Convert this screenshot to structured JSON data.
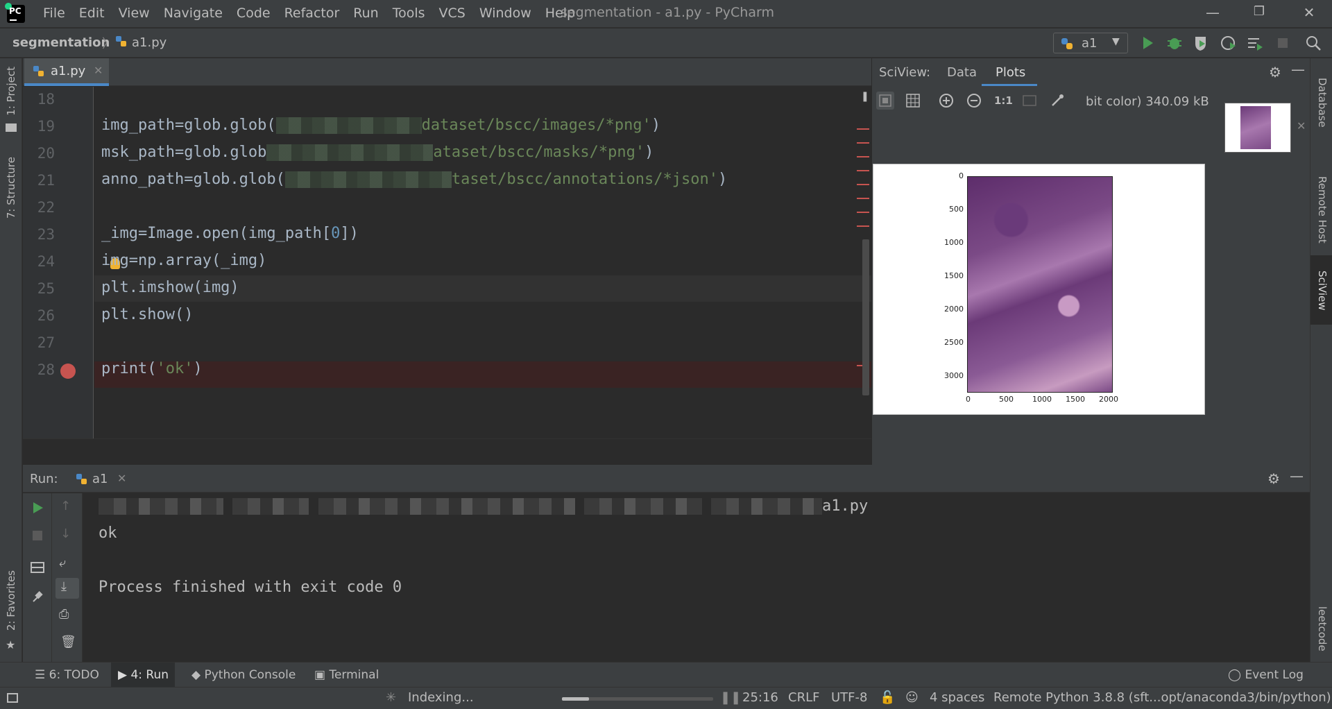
{
  "window": {
    "title": "segmentation - a1.py - PyCharm",
    "menu": [
      "File",
      "Edit",
      "View",
      "Navigate",
      "Code",
      "Refactor",
      "Run",
      "Tools",
      "VCS",
      "Window",
      "Help"
    ],
    "buttons": {
      "minimize": "—",
      "restore": "❐",
      "close": "✕"
    }
  },
  "navbar": {
    "project": "segmentation",
    "file": "a1.py",
    "run_config": "a1"
  },
  "left_strip": {
    "project": "1: Project",
    "structure": "7: Structure",
    "favorites": "2: Favorites"
  },
  "right_strip": {
    "database": "Database",
    "remote_host": "Remote Host",
    "sciview": "SciView",
    "leetcode": "leetcode"
  },
  "editor": {
    "tab": "a1.py",
    "lines": [
      {
        "n": "18",
        "parts": []
      },
      {
        "n": "19",
        "parts": [
          [
            "c",
            "img_path=glob.glob("
          ],
          [
            "r",
            ""
          ],
          [
            "s",
            "dataset/bscc/images/*png'"
          ],
          [
            "c",
            ")"
          ]
        ]
      },
      {
        "n": "20",
        "parts": [
          [
            "c",
            "msk_path=glob.glob"
          ],
          [
            "r",
            ""
          ],
          [
            "s",
            "ataset/bscc/masks/*png'"
          ],
          [
            "c",
            ")"
          ]
        ]
      },
      {
        "n": "21",
        "parts": [
          [
            "c",
            "anno_path=glob.glob("
          ],
          [
            "r",
            ""
          ],
          [
            "s",
            "taset/bscc/annotations/*json'"
          ],
          [
            "c",
            ")"
          ]
        ]
      },
      {
        "n": "22",
        "parts": []
      },
      {
        "n": "23",
        "parts": [
          [
            "c",
            "_img=Image.open(img_path["
          ],
          [
            "n",
            "0"
          ],
          [
            "c",
            "])"
          ]
        ]
      },
      {
        "n": "24",
        "parts": [
          [
            "c",
            "img=np.array(_img)"
          ]
        ]
      },
      {
        "n": "25",
        "parts": [
          [
            "c",
            "plt.imshow(img)"
          ]
        ]
      },
      {
        "n": "26",
        "parts": [
          [
            "c",
            "plt.show()"
          ]
        ]
      },
      {
        "n": "27",
        "parts": []
      },
      {
        "n": "28",
        "parts": [
          [
            "c",
            "print("
          ],
          [
            "s",
            "'ok'"
          ],
          [
            "c",
            ")"
          ]
        ]
      }
    ]
  },
  "sciview": {
    "title": "SciView:",
    "tabs": [
      "Data",
      "Plots"
    ],
    "active_tab": "Plots",
    "plot_info": "bit color) 340.09 kB",
    "zoom_reset": "1:1",
    "plot": {
      "yticks": [
        "0",
        "500",
        "1000",
        "1500",
        "2000",
        "2500",
        "3000"
      ],
      "xticks": [
        "0",
        "500",
        "1000",
        "1500",
        "2000"
      ]
    }
  },
  "run": {
    "label": "Run:",
    "tab": "a1",
    "console": {
      "cmd_suffix": "a1.py",
      "out": "ok",
      "exit": "Process finished with exit code 0"
    }
  },
  "bottom_tools": {
    "todo": "6: TODO",
    "run": "4: Run",
    "python_console": "Python Console",
    "terminal": "Terminal",
    "event_log": "Event Log"
  },
  "status": {
    "indexing": "Indexing...",
    "indexing_progress": 0.18,
    "position": "25:16",
    "line_sep": "CRLF",
    "encoding": "UTF-8",
    "indent": "4 spaces",
    "interpreter": "Remote Python 3.8.8 (sft...opt/anaconda3/bin/python)"
  },
  "colors": {
    "accent": "#4a88c7",
    "breakpoint": "#c75450",
    "run_green": "#499c54"
  }
}
